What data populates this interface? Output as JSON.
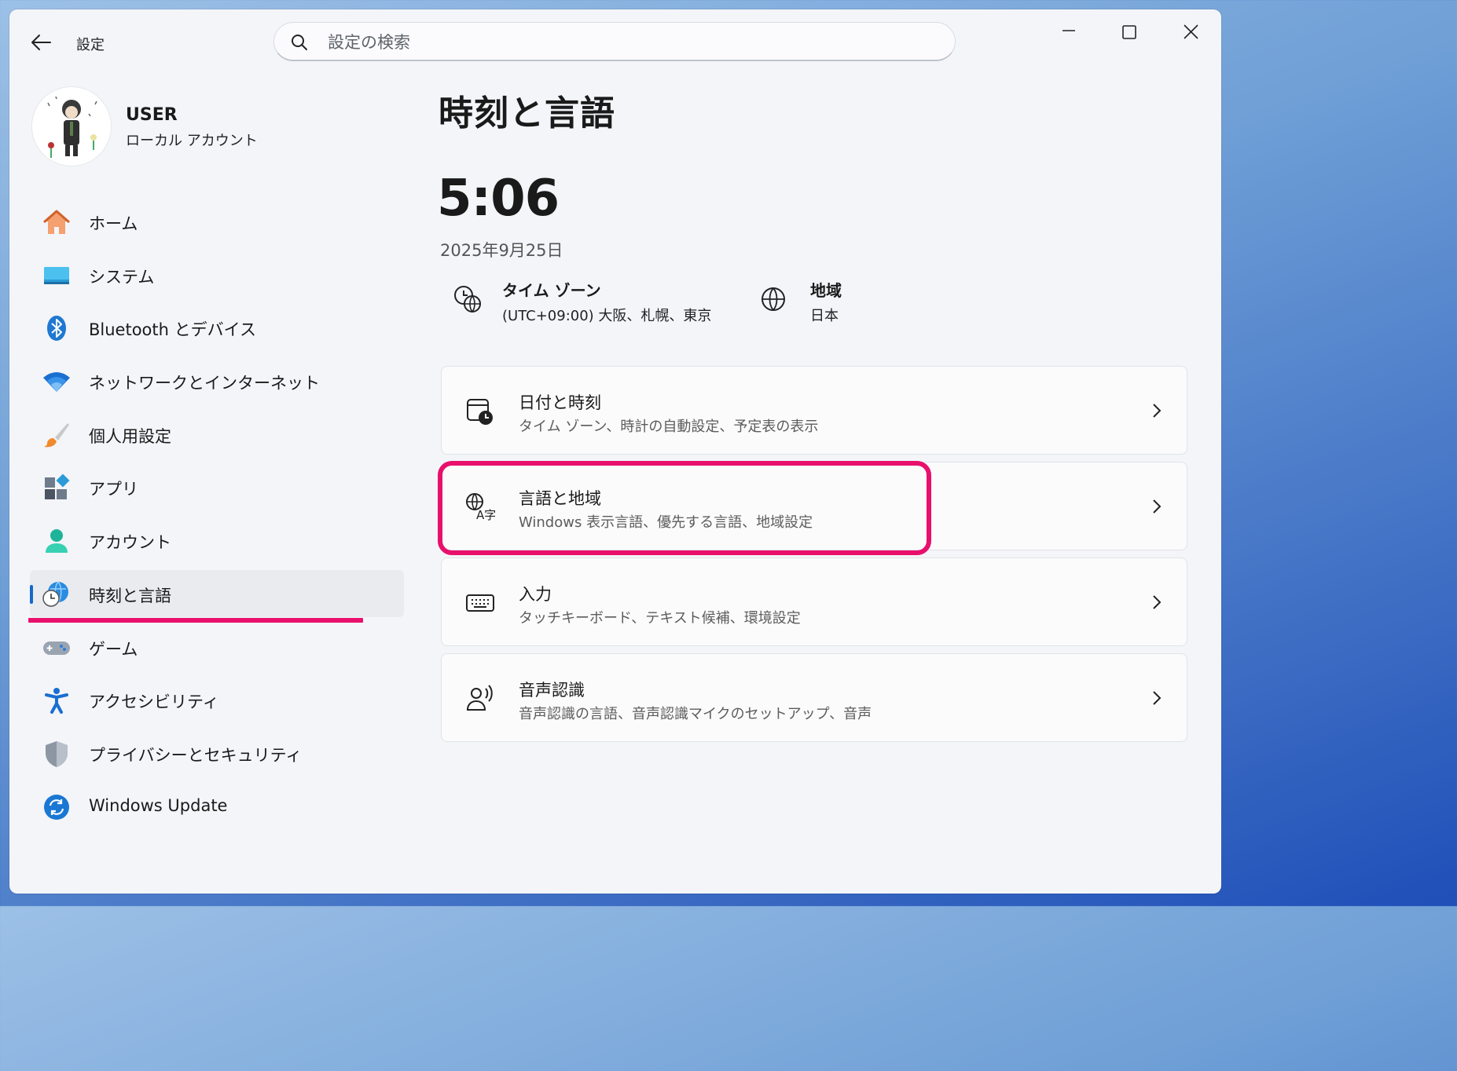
{
  "window": {
    "app_title": "設定",
    "search_placeholder": "設定の検索"
  },
  "profile": {
    "name": "USER",
    "account_type": "ローカル アカウント"
  },
  "sidebar": {
    "items": [
      {
        "label": "ホーム",
        "icon": "home-icon"
      },
      {
        "label": "システム",
        "icon": "system-icon"
      },
      {
        "label": "Bluetooth とデバイス",
        "icon": "bluetooth-icon"
      },
      {
        "label": "ネットワークとインターネット",
        "icon": "wifi-icon"
      },
      {
        "label": "個人用設定",
        "icon": "brush-icon"
      },
      {
        "label": "アプリ",
        "icon": "apps-icon"
      },
      {
        "label": "アカウント",
        "icon": "account-icon"
      },
      {
        "label": "時刻と言語",
        "icon": "time-language-icon",
        "active": true
      },
      {
        "label": "ゲーム",
        "icon": "gamepad-icon"
      },
      {
        "label": "アクセシビリティ",
        "icon": "accessibility-icon"
      },
      {
        "label": "プライバシーとセキュリティ",
        "icon": "shield-icon"
      },
      {
        "label": "Windows Update",
        "icon": "update-icon"
      }
    ]
  },
  "main": {
    "title": "時刻と言語",
    "clock": "5:06",
    "date": "2025年9月25日",
    "timezone": {
      "title": "タイム ゾーン",
      "value": "(UTC+09:00) 大阪、札幌、東京"
    },
    "region": {
      "title": "地域",
      "value": "日本"
    },
    "cards": [
      {
        "title": "日付と時刻",
        "subtitle": "タイム ゾーン、時計の自動設定、予定表の表示",
        "icon": "calendar-clock-icon"
      },
      {
        "title": "言語と地域",
        "subtitle": "Windows 表示言語、優先する言語、地域設定",
        "icon": "language-icon"
      },
      {
        "title": "入力",
        "subtitle": "タッチキーボード、テキスト候補、環境設定",
        "icon": "keyboard-icon"
      },
      {
        "title": "音声認識",
        "subtitle": "音声認識の言語、音声認識マイクのセットアップ、音声",
        "icon": "speech-icon"
      }
    ]
  },
  "colors": {
    "accent": "#1668c8",
    "highlight": "#e8106c",
    "background": "#f3f5f9"
  }
}
